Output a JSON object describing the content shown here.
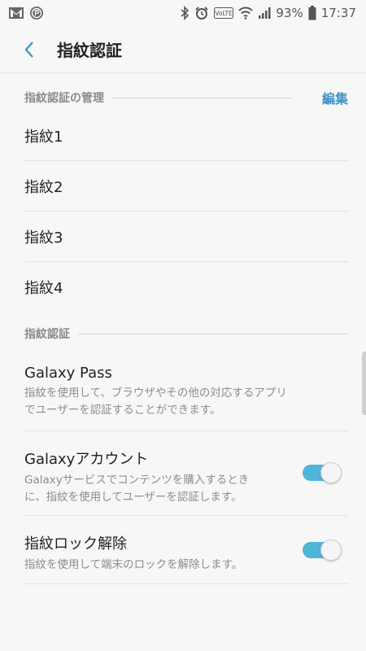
{
  "status_bar": {
    "battery_percent": "93%",
    "time": "17:37",
    "volte_label": "VoLTE",
    "icons_left": [
      "mail-icon",
      "p-circle-icon"
    ],
    "icons_right": [
      "bluetooth-icon",
      "alarm-icon",
      "volte-icon",
      "wifi-icon",
      "signal-icon",
      "battery-icon"
    ]
  },
  "app_bar": {
    "title": "指紋認証"
  },
  "management_section": {
    "header": "指紋認証の管理",
    "edit_label": "編集",
    "fingerprints": [
      {
        "label": "指紋1"
      },
      {
        "label": "指紋2"
      },
      {
        "label": "指紋3"
      },
      {
        "label": "指紋4"
      }
    ]
  },
  "auth_section": {
    "header": "指紋認証",
    "options": [
      {
        "title": "Galaxy Pass",
        "line1": "指紋を使用して、ブラウザやその他の対応するアプリ",
        "line2": "でユーザーを認証することができます。",
        "toggle": null
      },
      {
        "title": "Galaxyアカウント",
        "line1": "Galaxyサービスでコンテンツを購入するとき",
        "line2": "に、指紋を使用してユーザーを認証します。",
        "toggle": true
      },
      {
        "title": "指紋ロック解除",
        "line1": "指紋を使用して端末のロックを解除します。",
        "toggle": true
      }
    ]
  },
  "colors": {
    "accent": "#3a93c6",
    "toggle_on": "#4fb5d9",
    "background": "#f7f7f7",
    "divider": "#e2e2e2"
  }
}
